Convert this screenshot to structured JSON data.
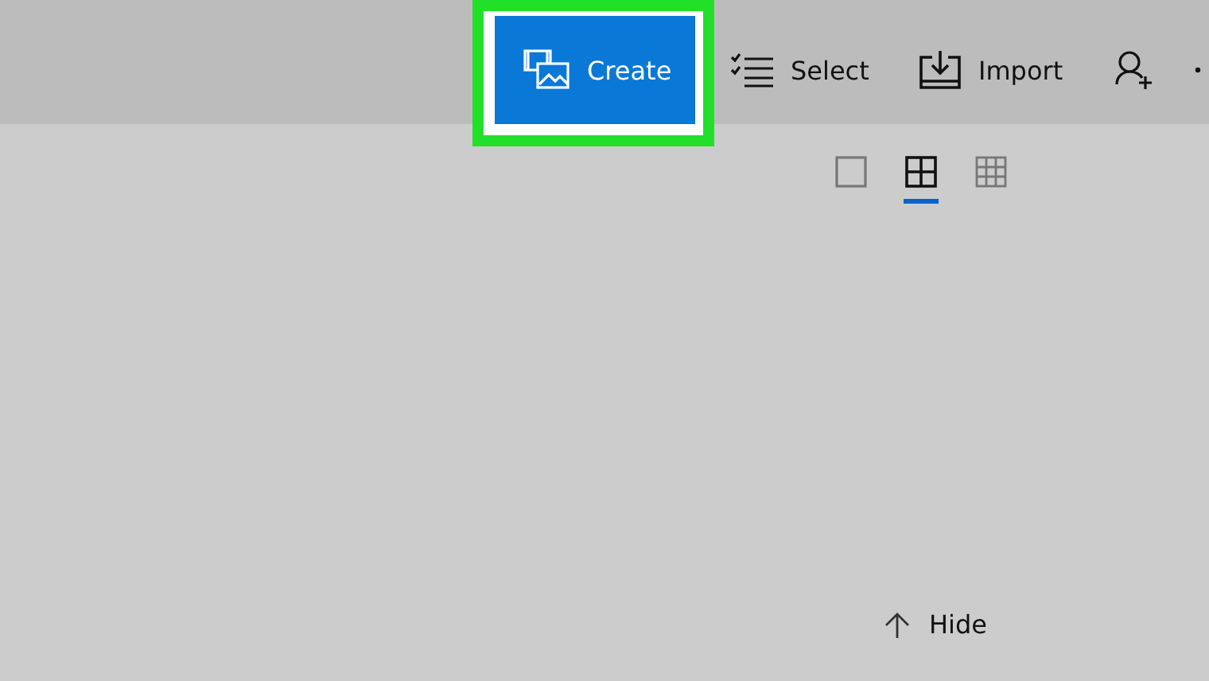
{
  "toolbar": {
    "buttons": [
      {
        "kind": "create",
        "label": "Create",
        "highlighted": true
      },
      {
        "kind": "select",
        "label": "Select",
        "highlighted": false
      },
      {
        "kind": "import",
        "label": "Import",
        "highlighted": false
      },
      {
        "kind": "add-person",
        "highlighted": false
      },
      {
        "kind": "more",
        "highlighted": false
      }
    ]
  },
  "view_options": [
    {
      "kind": "single",
      "selected": false
    },
    {
      "kind": "medium",
      "selected": true
    },
    {
      "kind": "small",
      "selected": false
    }
  ],
  "hide": {
    "label": "Hide"
  }
}
